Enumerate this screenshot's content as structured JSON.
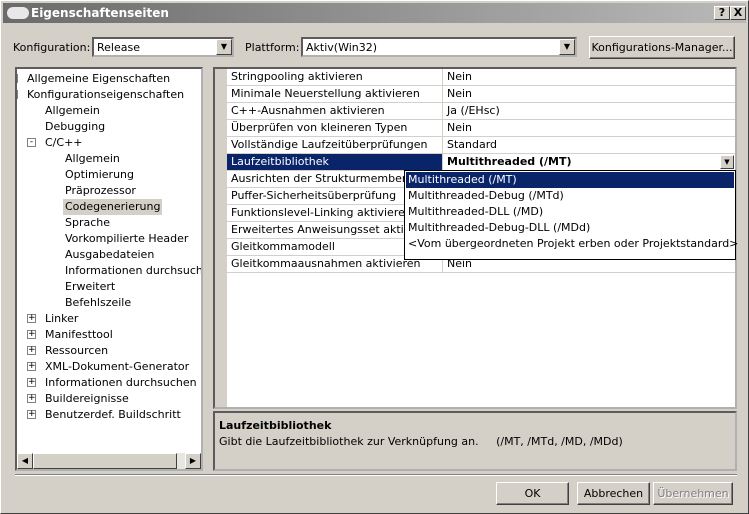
{
  "window": {
    "title": "Eigenschaftenseiten",
    "help_label": "?",
    "close_label": "X"
  },
  "config": {
    "konfiguration_label": "Konfiguration:",
    "konfiguration_value": "Release",
    "plattform_label": "Plattform:",
    "plattform_value": "Aktiv(Win32)",
    "manager_button": "Konfigurations-Manager..."
  },
  "tree": {
    "items": [
      {
        "label": "Allgemeine Eigenschaften",
        "expander": "+"
      },
      {
        "label": "Konfigurationseigenschaften",
        "expander": "-"
      },
      {
        "label": "Allgemein"
      },
      {
        "label": "Debugging"
      },
      {
        "label": "C/C++",
        "expander": "-"
      },
      {
        "label": "Allgemein"
      },
      {
        "label": "Optimierung"
      },
      {
        "label": "Präprozessor"
      },
      {
        "label": "Codegenerierung",
        "selected": true
      },
      {
        "label": "Sprache"
      },
      {
        "label": "Vorkompilierte Header"
      },
      {
        "label": "Ausgabedateien"
      },
      {
        "label": "Informationen durchsuchen"
      },
      {
        "label": "Erweitert"
      },
      {
        "label": "Befehlszeile"
      },
      {
        "label": "Linker",
        "expander": "+"
      },
      {
        "label": "Manifesttool",
        "expander": "+"
      },
      {
        "label": "Ressourcen",
        "expander": "+"
      },
      {
        "label": "XML-Dokument-Generator",
        "expander": "+"
      },
      {
        "label": "Informationen durchsuchen",
        "expander": "+"
      },
      {
        "label": "Buildereignisse",
        "expander": "+"
      },
      {
        "label": "Benutzerdef. Buildschritt",
        "expander": "+"
      }
    ]
  },
  "properties": {
    "rows": [
      {
        "name": "Stringpooling aktivieren",
        "value": "Nein"
      },
      {
        "name": "Minimale Neuerstellung aktivieren",
        "value": "Nein"
      },
      {
        "name": "C++-Ausnahmen aktivieren",
        "value": "Ja (/EHsc)"
      },
      {
        "name": "Überprüfen von kleineren Typen",
        "value": "Nein"
      },
      {
        "name": "Vollständige Laufzeitüberprüfungen",
        "value": "Standard"
      },
      {
        "name": "Laufzeitbibliothek",
        "value": "Multithreaded (/MT)"
      },
      {
        "name": "Ausrichten der Strukturmember",
        "value": ""
      },
      {
        "name": "Puffer-Sicherheitsüberprüfung",
        "value": ""
      },
      {
        "name": "Funktionslevel-Linking aktivieren",
        "value": ""
      },
      {
        "name": "Erweitertes Anweisungsset aktivieren",
        "value": ""
      },
      {
        "name": "Gleitkommamodell",
        "value": ""
      },
      {
        "name": "Gleitkommaausnahmen aktivieren",
        "value": "Nein"
      }
    ]
  },
  "dropdown": {
    "options": [
      "Multithreaded (/MT)",
      "Multithreaded-Debug (/MTd)",
      "Multithreaded-DLL (/MD)",
      "Multithreaded-Debug-DLL (/MDd)",
      "<Vom übergeordneten Projekt erben oder Projektstandard>"
    ]
  },
  "description": {
    "title": "Laufzeitbibliothek",
    "text": "Gibt die Laufzeitbibliothek zur Verknüpfung an.     (/MT, /MTd, /MD, /MDd)"
  },
  "buttons": {
    "ok": "OK",
    "cancel": "Abbrechen",
    "apply": "Übernehmen"
  }
}
